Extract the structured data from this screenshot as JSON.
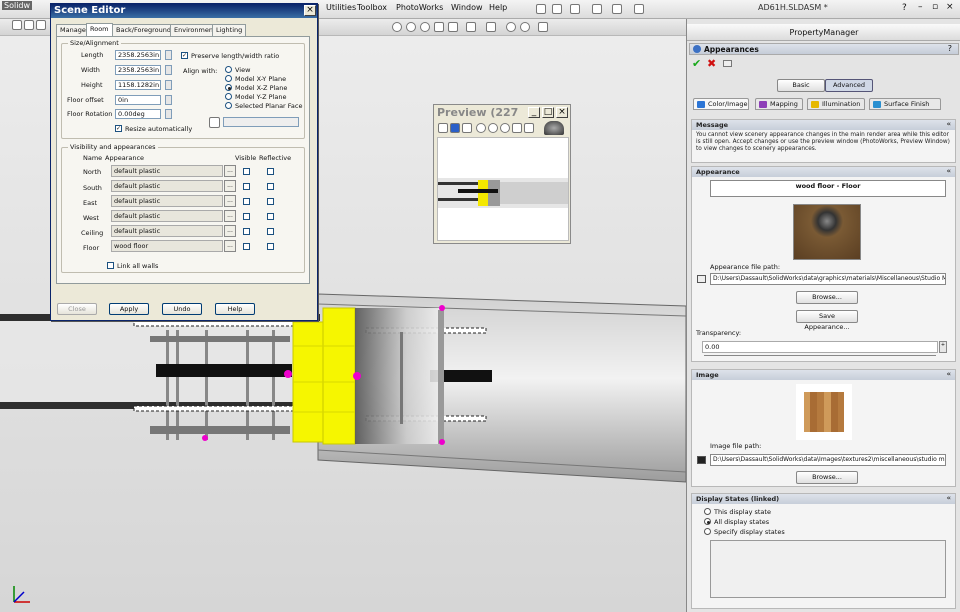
{
  "app": {
    "title_partial": "Solidw",
    "doc_title": "AD61H.SLDASM *",
    "menus": [
      "Utilities",
      "Toolbox",
      "PhotoWorks",
      "Window",
      "Help"
    ]
  },
  "scene_editor": {
    "title": "Scene Editor",
    "tabs": [
      "Manager",
      "Room",
      "Back/Foreground",
      "Environment",
      "Lighting"
    ],
    "active_tab": "Room",
    "size_group": "Size/Alignment",
    "length_label": "Length",
    "length": "2358.2563in",
    "width_label": "Width",
    "width": "2358.2563in",
    "height_label": "Height",
    "height": "1158.1282in",
    "floor_offset_label": "Floor offset",
    "floor_offset": "0in",
    "floor_rotation_label": "Floor Rotation",
    "floor_rotation": "0.00deg",
    "preserve_ratio": "Preserve length/width ratio",
    "resize_auto": "Resize automatically",
    "align_with": "Align with:",
    "align_options": [
      "View",
      "Model X-Y Plane",
      "Model X-Z Plane",
      "Model Y-Z Plane",
      "Selected Planar Face"
    ],
    "align_selected": 2,
    "vis_group": "Visibility and appearances",
    "col_name": "Name",
    "col_appearance": "Appearance",
    "col_visible": "Visible",
    "col_reflective": "Reflective",
    "rows": [
      {
        "name": "North",
        "appearance": "default plastic"
      },
      {
        "name": "South",
        "appearance": "default plastic"
      },
      {
        "name": "East",
        "appearance": "default plastic"
      },
      {
        "name": "West",
        "appearance": "default plastic"
      },
      {
        "name": "Ceiling",
        "appearance": "default plastic"
      },
      {
        "name": "Floor",
        "appearance": "wood floor"
      }
    ],
    "link_walls": "Link all walls",
    "buttons": [
      "Close",
      "Apply",
      "Undo",
      "Help"
    ]
  },
  "preview": {
    "title": "Preview (227"
  },
  "property_manager": {
    "header": "PropertyManager",
    "panel_title": "Appearances",
    "help": "?",
    "mode_basic": "Basic",
    "mode_advanced": "Advanced",
    "tabs": [
      "Color/Image",
      "Mapping",
      "Illumination",
      "Surface Finish"
    ],
    "message_title": "Message",
    "message": "You cannot view scenery appearance changes in the main render area while this editor is still open.  Accept changes or use the preview window (PhotoWorks, Preview Window) to view changes to scenery appearances.",
    "appearance_title": "Appearance",
    "appearance_name": "wood floor - Floor",
    "appearance_path_label": "Appearance file path:",
    "appearance_path": "D:\\Users\\Dassault\\SolidWorks\\data\\graphics\\materials\\Miscellaneous\\Studio Mater",
    "browse": "Browse...",
    "save_appearance": "Save Appearance...",
    "transparency_label": "Transparency:",
    "transparency": "0.00",
    "image_title": "Image",
    "image_path_label": "Image file path:",
    "image_path": "D:\\Users\\Dassault\\SolidWorks\\data\\Images\\textures2\\miscellaneous\\studio mater",
    "display_states_title": "Display States (linked)",
    "display_options": [
      "This display state",
      "All display states",
      "Specify display states"
    ],
    "display_selected": 1
  }
}
